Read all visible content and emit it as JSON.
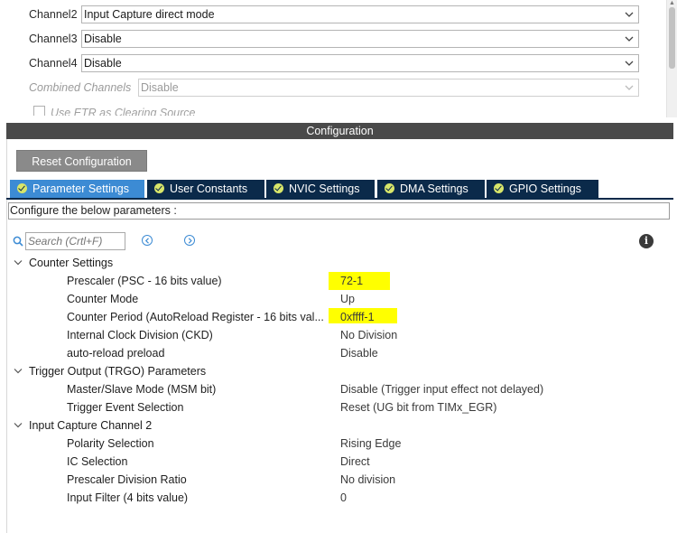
{
  "channels": [
    {
      "label": "Channel2",
      "value": "Input Capture direct mode"
    },
    {
      "label": "Channel3",
      "value": "Disable"
    },
    {
      "label": "Channel4",
      "value": "Disable"
    },
    {
      "label": "Combined Channels",
      "value": "Disable"
    }
  ],
  "etr_label": "Use ETR as Clearing Source",
  "config_title": "Configuration",
  "reset_button": "Reset Configuration",
  "tabs": [
    {
      "label": "Parameter Settings",
      "active": true
    },
    {
      "label": "User Constants"
    },
    {
      "label": "NVIC Settings"
    },
    {
      "label": "DMA Settings"
    },
    {
      "label": "GPIO Settings"
    }
  ],
  "description": "Configure the below parameters :",
  "search": {
    "placeholder": "Search (Crtl+F)"
  },
  "groups": [
    {
      "label": "Counter Settings",
      "params": [
        {
          "name": "Prescaler (PSC - 16 bits value)",
          "value": "72-1",
          "highlighted": true
        },
        {
          "name": "Counter Mode",
          "value": "Up"
        },
        {
          "name": "Counter Period (AutoReload Register - 16 bits val...",
          "value": "0xffff-1",
          "highlighted": true
        },
        {
          "name": "Internal Clock Division (CKD)",
          "value": "No Division"
        },
        {
          "name": "auto-reload preload",
          "value": "Disable"
        }
      ]
    },
    {
      "label": "Trigger Output (TRGO) Parameters",
      "params": [
        {
          "name": "Master/Slave Mode (MSM bit)",
          "value": "Disable (Trigger input effect not delayed)"
        },
        {
          "name": "Trigger Event Selection",
          "value": "Reset (UG bit from TIMx_EGR)"
        }
      ]
    },
    {
      "label": "Input Capture Channel 2",
      "params": [
        {
          "name": "Polarity Selection",
          "value": "Rising Edge"
        },
        {
          "name": "IC Selection",
          "value": "Direct"
        },
        {
          "name": "Prescaler Division Ratio",
          "value": "No division"
        },
        {
          "name": "Input Filter (4 bits value)",
          "value": "0"
        }
      ]
    }
  ],
  "colors": {
    "tab_bg": "#0b2a4a",
    "tab_active": "#3c8bd4",
    "highlight": "#ffff00",
    "header": "#4a4a4a"
  }
}
